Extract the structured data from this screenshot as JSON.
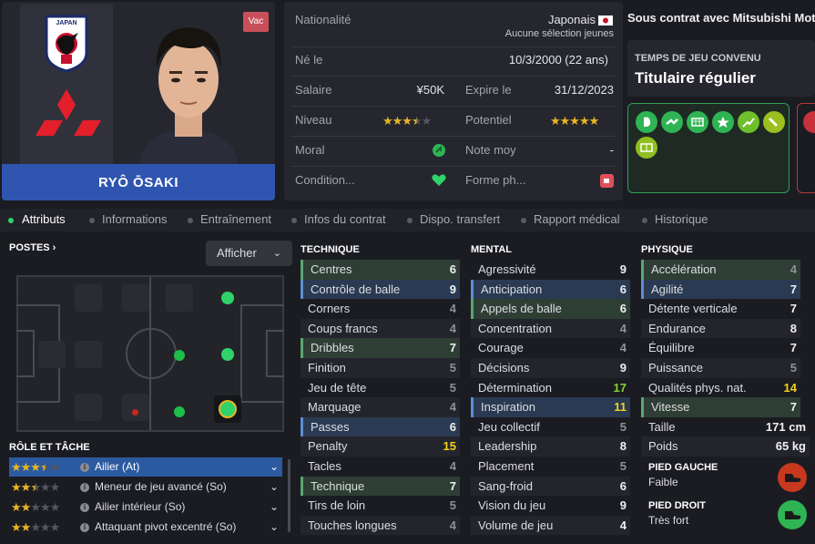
{
  "player": {
    "name": "RYÔ ŌSAKI",
    "badge": "Vac",
    "flag_text": "JAPAN"
  },
  "info": {
    "nationality_label": "Nationalité",
    "nationality_value": "Japonais",
    "caps_note": "Aucune sélection jeunes",
    "born_label": "Né le",
    "born_value": "10/3/2000 (22 ans)",
    "salary_label": "Salaire",
    "salary_value": "¥50K",
    "expires_label": "Expire le",
    "expires_value": "31/12/2023",
    "level_label": "Niveau",
    "level_stars": 3.5,
    "potential_label": "Potentiel",
    "potential_stars": 5,
    "morale_label": "Moral",
    "avg_label": "Note moy",
    "avg_value": "-",
    "condition_label": "Condition...",
    "form_label": "Forme ph..."
  },
  "contract": {
    "text": "Sous contrat avec Mitsubishi Motors",
    "playing_time_label": "TEMPS DE JEU CONVENU",
    "playing_time_value": "Titulaire régulier"
  },
  "tabs": [
    "Attributs",
    "Informations",
    "Entraînement",
    "Infos du contrat",
    "Dispo. transfert",
    "Rapport médical",
    "Historique"
  ],
  "positions": {
    "header": "POSTES",
    "display_label": "Afficher"
  },
  "roles": {
    "header": "RÔLE ET TÂCHE",
    "items": [
      {
        "stars": 3.5,
        "label": "Ailier (At)"
      },
      {
        "stars": 2.5,
        "label": "Meneur de jeu avancé (So)"
      },
      {
        "stars": 2,
        "label": "Ailier intérieur (So)"
      },
      {
        "stars": 2,
        "label": "Attaquant pivot excentré (So)"
      }
    ]
  },
  "technique": {
    "header": "TECHNIQUE",
    "rows": [
      {
        "name": "Centres",
        "value": "6"
      },
      {
        "name": "Contrôle de balle",
        "value": "9"
      },
      {
        "name": "Corners",
        "value": "4"
      },
      {
        "name": "Coups francs",
        "value": "4"
      },
      {
        "name": "Dribbles",
        "value": "7"
      },
      {
        "name": "Finition",
        "value": "5"
      },
      {
        "name": "Jeu de tête",
        "value": "5"
      },
      {
        "name": "Marquage",
        "value": "4"
      },
      {
        "name": "Passes",
        "value": "6"
      },
      {
        "name": "Penalty",
        "value": "15"
      },
      {
        "name": "Tacles",
        "value": "4"
      },
      {
        "name": "Technique",
        "value": "7"
      },
      {
        "name": "Tirs de loin",
        "value": "5"
      },
      {
        "name": "Touches longues",
        "value": "4"
      }
    ]
  },
  "mental": {
    "header": "MENTAL",
    "rows": [
      {
        "name": "Agressivité",
        "value": "9"
      },
      {
        "name": "Anticipation",
        "value": "6"
      },
      {
        "name": "Appels de balle",
        "value": "6"
      },
      {
        "name": "Concentration",
        "value": "4"
      },
      {
        "name": "Courage",
        "value": "4"
      },
      {
        "name": "Décisions",
        "value": "9"
      },
      {
        "name": "Détermination",
        "value": "17"
      },
      {
        "name": "Inspiration",
        "value": "11"
      },
      {
        "name": "Jeu collectif",
        "value": "5"
      },
      {
        "name": "Leadership",
        "value": "8"
      },
      {
        "name": "Placement",
        "value": "5"
      },
      {
        "name": "Sang-froid",
        "value": "6"
      },
      {
        "name": "Vision du jeu",
        "value": "9"
      },
      {
        "name": "Volume de jeu",
        "value": "4"
      }
    ]
  },
  "physique": {
    "header": "PHYSIQUE",
    "rows": [
      {
        "name": "Accélération",
        "value": "4"
      },
      {
        "name": "Agilité",
        "value": "7"
      },
      {
        "name": "Détente verticale",
        "value": "7"
      },
      {
        "name": "Endurance",
        "value": "8"
      },
      {
        "name": "Équilibre",
        "value": "7"
      },
      {
        "name": "Puissance",
        "value": "5"
      },
      {
        "name": "Qualités phys. nat.",
        "value": "14"
      },
      {
        "name": "Vitesse",
        "value": "7"
      },
      {
        "name": "Taille",
        "value": "171 cm"
      },
      {
        "name": "Poids",
        "value": "65 kg"
      }
    ],
    "left_foot_label": "PIED GAUCHE",
    "left_foot_value": "Faible",
    "right_foot_label": "PIED DROIT",
    "right_foot_value": "Très fort"
  },
  "colors": {
    "accent_blue": "#2f55b0",
    "star": "#e8b623",
    "green": "#2fb453",
    "highlight_green": "#8bd13a",
    "highlight_yellow": "#f2d21c"
  }
}
